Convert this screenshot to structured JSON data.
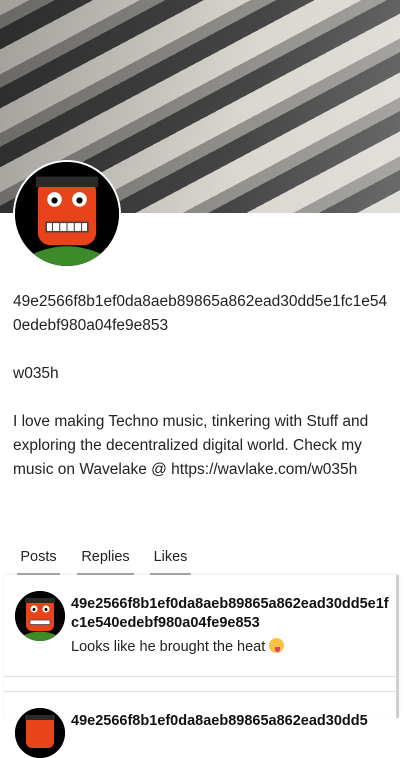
{
  "profile": {
    "pubkey": "49e2566f8b1ef0da8aeb89865a862ead30dd5e1fc1e540edebf980a04fe9e853",
    "name": "w035h",
    "bio": "I love making Techno music, tinkering with Stuff and exploring the decentralized digital world. Check my music on Wavelake @ https://wavlake.com/w035h"
  },
  "tabs": [
    "Posts",
    "Replies",
    "Likes"
  ],
  "posts": [
    {
      "author": "49e2566f8b1ef0da8aeb89865a862ead30dd5e1fc1e540edebf980a04fe9e853",
      "text": "Looks like he brought the heat",
      "emoji": "face-with-tongue-icon"
    },
    {
      "author": "49e2566f8b1ef0da8aeb89865a862ead30dd5"
    }
  ],
  "colors": {
    "avatar_face": "#e8431a",
    "avatar_bg": "#000000",
    "tab_underline": "#aaaaaa"
  }
}
